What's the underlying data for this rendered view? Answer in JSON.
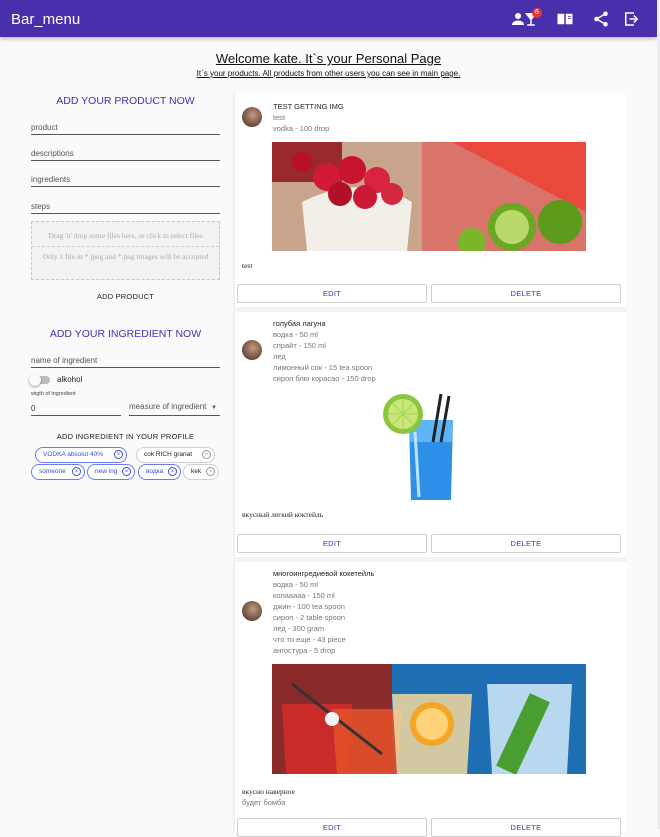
{
  "appbar": {
    "title": "Bar_menu",
    "badge_count": "6",
    "icons": [
      "person-icon",
      "cocktail-icon",
      "menu-book-icon",
      "share-icon",
      "logout-icon"
    ]
  },
  "welcome": {
    "heading": "Welcome kate. It`s your Personal Page",
    "subheading": "It`s your products. All products from other users you can see in main page."
  },
  "product_form": {
    "title": "ADD YOUR PRODUCT NOW",
    "product_placeholder": "product",
    "descriptions_placeholder": "descriptions",
    "ingredients_placeholder": "ingredients",
    "steps_placeholder": "steps",
    "dropzone_text": "Drag 'n' drop some files here, or click to select files",
    "dropzone_hint": "Only 1 file in *.jpeg and *.png images will be accepted",
    "submit_label": "ADD PRODUCT"
  },
  "ingredient_form": {
    "title": "ADD YOUR INGREDIENT NOW",
    "name_placeholder": "name of ingredient",
    "alkohol_label": "alkohol",
    "weight_label": "wigth of ingredient",
    "weight_value": "0",
    "measure_placeholder": "measure of ingredient",
    "submit_label": "ADD INGREDIENT IN YOUR PROFILE",
    "chips": [
      {
        "label": "VODKA absolut 40%",
        "style": "blue"
      },
      {
        "label": "cok RICH granat",
        "style": "grey"
      },
      {
        "label": "someone",
        "style": "blue"
      },
      {
        "label": "new ing",
        "style": "blue"
      },
      {
        "label": "водка",
        "style": "blue"
      },
      {
        "label": "kek",
        "style": "grey"
      }
    ]
  },
  "products": [
    {
      "title": "TEST GETTING IMG",
      "lines": [
        "test",
        "vodka - 100 drop"
      ],
      "image": "raspberries-lime-cocktail",
      "description": "test",
      "extra": "",
      "edit_label": "EDIT",
      "delete_label": "DELETE"
    },
    {
      "title": "голубая лагуна",
      "lines": [
        "водка - 50 ml",
        "спрайт - 150 ml",
        "лед",
        "лимонный сок - 15 tea spoon",
        "сироп блю корасао - 150 drop"
      ],
      "image": "blue-lagoon-glass",
      "description": "вкусный легкий коктейль",
      "extra": "",
      "edit_label": "EDIT",
      "delete_label": "DELETE"
    },
    {
      "title": "многоингредиевой кокетейль",
      "lines": [
        "водка - 50 ml",
        "колааааа - 150 ml",
        "джин - 100 tea spoon",
        "сироп - 2 table spoon",
        "лед - 300 gram",
        "что то еще - 43 piece",
        "ангостура - 5 drop"
      ],
      "image": "assorted-cocktails",
      "description": "вкусно наверное",
      "extra": "будет бомба",
      "edit_label": "EDIT",
      "delete_label": "DELETE"
    }
  ],
  "colors": {
    "appbar": "#4a2fad",
    "accent": "#4a2fad",
    "chip_blue": "#3b4bd6",
    "badge": "#e53935"
  }
}
